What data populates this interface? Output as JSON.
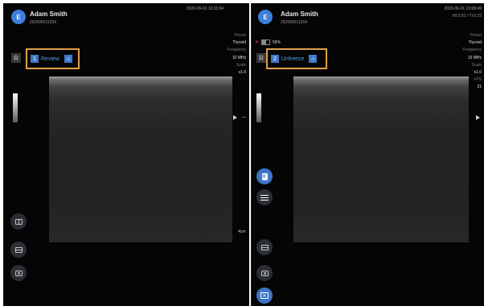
{
  "left": {
    "patient_name": "Adam Smith",
    "patient_id": "262006011254",
    "datetime": "2020-06-01 13:11:04",
    "logo_text": "E",
    "orientation_label": "R",
    "mode_number": "1",
    "mode_label": "Review",
    "params": [
      {
        "label": "Preset",
        "value": "Thyroid"
      },
      {
        "label": "Frequency",
        "value": "10 MHz"
      },
      {
        "label": "Scale",
        "value": "x1.0"
      }
    ],
    "depth_label": "4cm",
    "buttons": [
      "book-icon",
      "split-icon",
      "camera-icon"
    ]
  },
  "right": {
    "patient_name": "Adam Smith",
    "patient_id": "262006011254",
    "datetime": "2020-06-01 13:08:49",
    "mi_ti": "MI:0.82 / TI:0.33",
    "logo_text": "E",
    "battery_pct": "58%",
    "orientation_label": "R",
    "mode_number": "2",
    "mode_label": "Unfreeze",
    "params": [
      {
        "label": "Preset",
        "value": "Thyroid"
      },
      {
        "label": "Frequency",
        "value": "10 MHz"
      },
      {
        "label": "Scale",
        "value": "x1.0"
      },
      {
        "label": "FPS",
        "value": "21"
      }
    ],
    "buttons": [
      "document-icon",
      "menu-lines-icon",
      "split-icon",
      "camera-icon",
      "exit-icon"
    ]
  },
  "colors": {
    "accent_blue": "#3f78c8",
    "highlight_orange": "#e0a14d",
    "background": "#050505"
  }
}
